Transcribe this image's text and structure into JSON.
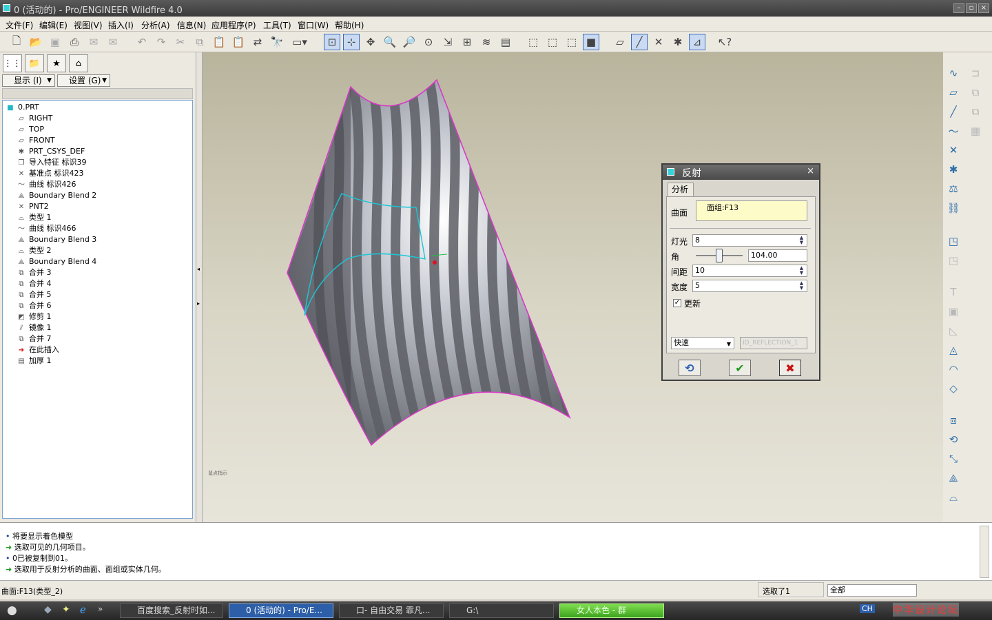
{
  "window": {
    "title": "0 (活动的) - Pro/ENGINEER Wildfire 4.0"
  },
  "menu": [
    "文件(F)",
    "编辑(E)",
    "视图(V)",
    "插入(I)",
    "分析(A)",
    "信息(N)",
    "应用程序(P)",
    "工具(T)",
    "窗口(W)",
    "帮助(H)"
  ],
  "left_panel": {
    "show_label": "显示 (I)",
    "settings_label": "设置 (G)",
    "tree": [
      {
        "label": "0.PRT",
        "icon": "part-icon"
      },
      {
        "label": "RIGHT",
        "icon": "datum-plane-icon"
      },
      {
        "label": "TOP",
        "icon": "datum-plane-icon"
      },
      {
        "label": "FRONT",
        "icon": "datum-plane-icon"
      },
      {
        "label": "PRT_CSYS_DEF",
        "icon": "csys-icon"
      },
      {
        "label": "导入特征 标识39",
        "icon": "import-icon"
      },
      {
        "label": "基准点 标识423",
        "icon": "datum-point-icon"
      },
      {
        "label": "曲线 标识426",
        "icon": "curve-icon"
      },
      {
        "label": "Boundary Blend 2",
        "icon": "boundary-blend-icon"
      },
      {
        "label": "PNT2",
        "icon": "datum-point-icon"
      },
      {
        "label": "类型 1",
        "icon": "surface-icon"
      },
      {
        "label": "曲线 标识466",
        "icon": "curve-icon"
      },
      {
        "label": "Boundary Blend 3",
        "icon": "boundary-blend-icon"
      },
      {
        "label": "类型 2",
        "icon": "surface-icon"
      },
      {
        "label": "Boundary Blend 4",
        "icon": "boundary-blend-icon"
      },
      {
        "label": "合并 3",
        "icon": "merge-icon"
      },
      {
        "label": "合并 4",
        "icon": "merge-icon"
      },
      {
        "label": "合并 5",
        "icon": "merge-icon"
      },
      {
        "label": "合并 6",
        "icon": "merge-icon"
      },
      {
        "label": "修剪 1",
        "icon": "trim-icon"
      },
      {
        "label": "镜像 1",
        "icon": "mirror-icon"
      },
      {
        "label": "合并 7",
        "icon": "merge-icon"
      },
      {
        "label": "在此插入",
        "icon": "insert-here-icon"
      },
      {
        "label": "加厚 1",
        "icon": "thicken-icon"
      }
    ]
  },
  "viewport": {
    "tiny_label": "鼠点指示"
  },
  "dialog": {
    "title": "反射",
    "tab": "分析",
    "surface_label": "曲面",
    "surface_value": "面组:F13",
    "light_label": "灯光",
    "light_value": "8",
    "angle_label": "角",
    "angle_value": "104.00",
    "angle_level": 0.5,
    "spacing_label": "间距",
    "spacing_value": "10",
    "width_label": "宽度",
    "width_value": "5",
    "update_label": "更新",
    "update_checked": true,
    "mode_value": "快速",
    "result_value": "ID_REFLECTION_1"
  },
  "messages": [
    {
      "icon": "bullet-icon",
      "text": "将要显示着色模型"
    },
    {
      "icon": "arrow-icon",
      "text": "选取可见的几何项目。"
    },
    {
      "icon": "bullet-icon",
      "text": "0已被复制到01。"
    },
    {
      "icon": "arrow-icon",
      "text": "选取用于反射分析的曲面、面组或实体几何。"
    }
  ],
  "status": {
    "left": "曲面:F13(类型_2)",
    "selected": "选取了1",
    "filter": "全部"
  },
  "taskbar": {
    "items": [
      "百度搜索_反射时如...",
      "0 (活动的) - Pro/E...",
      "口- 自由交易 霏凡...",
      "G:\\",
      "女人本色 - 群"
    ],
    "lang": "CH",
    "watermark": "中华设计论坛"
  },
  "colors": {
    "accent": "#3b6bb5",
    "edge": "#d838c8",
    "curve": "#18c8d8",
    "ok": "#1b9a1b",
    "cancel": "#c81010"
  }
}
